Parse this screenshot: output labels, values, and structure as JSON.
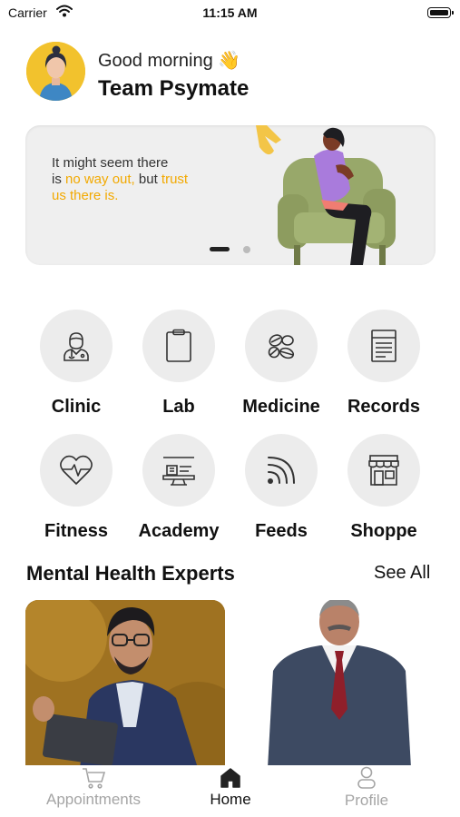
{
  "status_bar": {
    "carrier": "Carrier",
    "time": "11:15 AM"
  },
  "header": {
    "greeting": "Good morning",
    "greeting_emoji": "👋",
    "user_name": "Team Psymate"
  },
  "banner": {
    "line1": "It might seem there",
    "line2_a": "is ",
    "line2_hl": "no way out,",
    "line2_b": " but ",
    "line2_hl2": "trust",
    "line3_hl": "us there is.",
    "highlight_color": "#f2a900",
    "page_count": 2,
    "active_page": 1
  },
  "services": [
    {
      "label": "Clinic",
      "icon": "doctor-icon"
    },
    {
      "label": "Lab",
      "icon": "clipboard-icon"
    },
    {
      "label": "Medicine",
      "icon": "pills-icon"
    },
    {
      "label": "Records",
      "icon": "document-icon"
    },
    {
      "label": "Fitness",
      "icon": "heart-pulse-icon"
    },
    {
      "label": "Academy",
      "icon": "academy-icon"
    },
    {
      "label": "Feeds",
      "icon": "feed-icon"
    },
    {
      "label": "Shoppe",
      "icon": "store-icon"
    }
  ],
  "experts": {
    "title": "Mental Health Experts",
    "see_all": "See All"
  },
  "tab_bar": {
    "tabs": [
      {
        "label": "Appointments",
        "icon": "cart-icon",
        "active": false
      },
      {
        "label": "Home",
        "icon": "home-icon",
        "active": true
      },
      {
        "label": "Profile",
        "icon": "profile-icon",
        "active": false
      }
    ]
  }
}
